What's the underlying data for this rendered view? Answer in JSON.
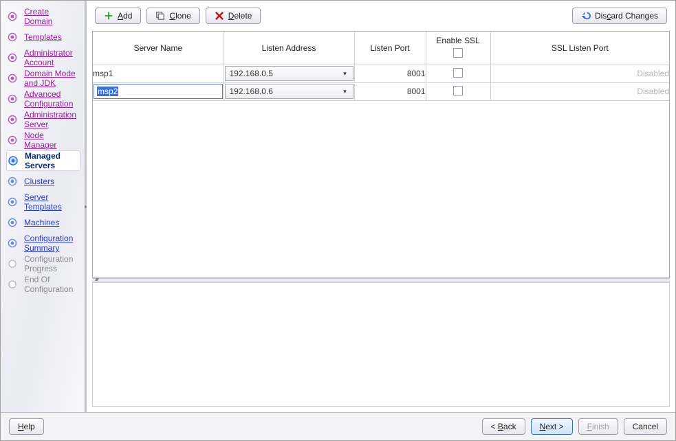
{
  "sidebar": {
    "items": [
      {
        "label": "Create Domain",
        "state": "done",
        "interact": true
      },
      {
        "label": "Templates",
        "state": "done",
        "interact": true
      },
      {
        "label": "Administrator Account",
        "state": "done",
        "interact": true
      },
      {
        "label": "Domain Mode and JDK",
        "state": "done",
        "interact": true
      },
      {
        "label": "Advanced Configuration",
        "state": "done",
        "interact": true
      },
      {
        "label": "Administration Server",
        "state": "done",
        "interact": true
      },
      {
        "label": "Node Manager",
        "state": "done",
        "interact": true
      },
      {
        "label": "Managed Servers",
        "state": "active",
        "interact": true
      },
      {
        "label": "Clusters",
        "state": "future",
        "interact": true
      },
      {
        "label": "Server Templates",
        "state": "future",
        "interact": true
      },
      {
        "label": "Machines",
        "state": "future",
        "interact": true
      },
      {
        "label": "Configuration Summary",
        "state": "future",
        "interact": true
      },
      {
        "label": "Configuration Progress",
        "state": "pending",
        "interact": false
      },
      {
        "label": "End Of Configuration",
        "state": "pending",
        "interact": false
      }
    ]
  },
  "toolbar": {
    "add": {
      "label": "Add",
      "underline": "A"
    },
    "clone": {
      "label": "Clone",
      "underline": "C"
    },
    "delete": {
      "label": "Delete",
      "underline": "D"
    },
    "discard": {
      "label": "Discard Changes",
      "underline": "c"
    }
  },
  "table": {
    "columns": {
      "name": "Server Name",
      "addr": "Listen Address",
      "port": "Listen Port",
      "ssl": "Enable SSL",
      "sslp": "SSL Listen Port"
    },
    "rows": [
      {
        "name": "msp1",
        "addr": "192.168.0.5",
        "port": "8001",
        "ssl": false,
        "sslp": "Disabled",
        "editing": false
      },
      {
        "name": "msp2",
        "addr": "192.168.0.6",
        "port": "8001",
        "ssl": false,
        "sslp": "Disabled",
        "editing": true
      }
    ]
  },
  "footer": {
    "help": "Help",
    "back": "< Back",
    "next": "Next >",
    "finish": "Finish",
    "cancel": "Cancel"
  }
}
